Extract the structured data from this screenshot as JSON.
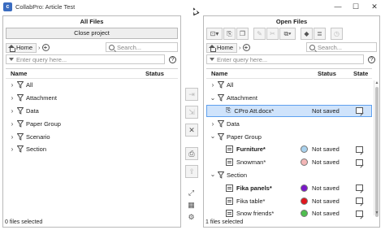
{
  "window": {
    "title": "CollabPro: Article Test",
    "minimize_glyph": "—",
    "maximize_glyph": "☐",
    "close_glyph": "✕"
  },
  "left_panel": {
    "title": "All Files",
    "close_project_label": "Close project",
    "breadcrumb_home": "Home",
    "search_placeholder": "Search...",
    "query_placeholder": "Enter query here...",
    "columns": {
      "name": "Name",
      "status": "Status"
    },
    "items": [
      {
        "label": "All"
      },
      {
        "label": "Attachment"
      },
      {
        "label": "Data"
      },
      {
        "label": "Paper Group"
      },
      {
        "label": "Scenario"
      },
      {
        "label": "Section"
      }
    ],
    "status_text": "0 files selected"
  },
  "right_panel": {
    "title": "Open Files",
    "breadcrumb_home": "Home",
    "search_placeholder": "Search...",
    "query_placeholder": "Enter query here...",
    "columns": {
      "name": "Name",
      "status": "Status",
      "state": "State"
    },
    "rows": [
      {
        "label": "All",
        "kind": "group",
        "expanded": false
      },
      {
        "label": "Attachment",
        "kind": "group",
        "expanded": true
      },
      {
        "label": "CPro Att.docx*",
        "kind": "file",
        "status": "Not saved",
        "selected": true,
        "icon": "paperclip-icon"
      },
      {
        "label": "Data",
        "kind": "group",
        "expanded": false
      },
      {
        "label": "Paper Group",
        "kind": "group",
        "expanded": true
      },
      {
        "label": "Furniture*",
        "kind": "file",
        "bold": true,
        "status": "Not saved",
        "dot_color": "#a9d2ee"
      },
      {
        "label": "Snowman*",
        "kind": "file",
        "status": "Not saved",
        "dot_color": "#f3b6b6"
      },
      {
        "label": "Section",
        "kind": "group",
        "expanded": true
      },
      {
        "label": "Fika panels*",
        "kind": "file",
        "bold": true,
        "status": "Not saved",
        "dot_color": "#7a17c9"
      },
      {
        "label": "Fika table*",
        "kind": "file",
        "status": "Not saved",
        "dot_color": "#e1161d"
      },
      {
        "label": "Snow friends*",
        "kind": "file",
        "status": "Not saved",
        "dot_color": "#4fbe4f"
      }
    ],
    "status_text": "1 files selected"
  },
  "icons": {
    "toolbar": [
      "new-file-dropdown-icon",
      "attach-icon",
      "copy-icon",
      "edit-icon",
      "link-broken-icon",
      "duplicate-dropdown-icon",
      "tag-icon",
      "details-icon",
      "history-icon"
    ],
    "transfer": [
      "add-to-open-icon",
      "add-all-to-open-icon",
      "close-file-icon",
      "print-icon",
      "export-icon",
      "expand-icon",
      "table-view-icon",
      "settings-icon"
    ]
  }
}
